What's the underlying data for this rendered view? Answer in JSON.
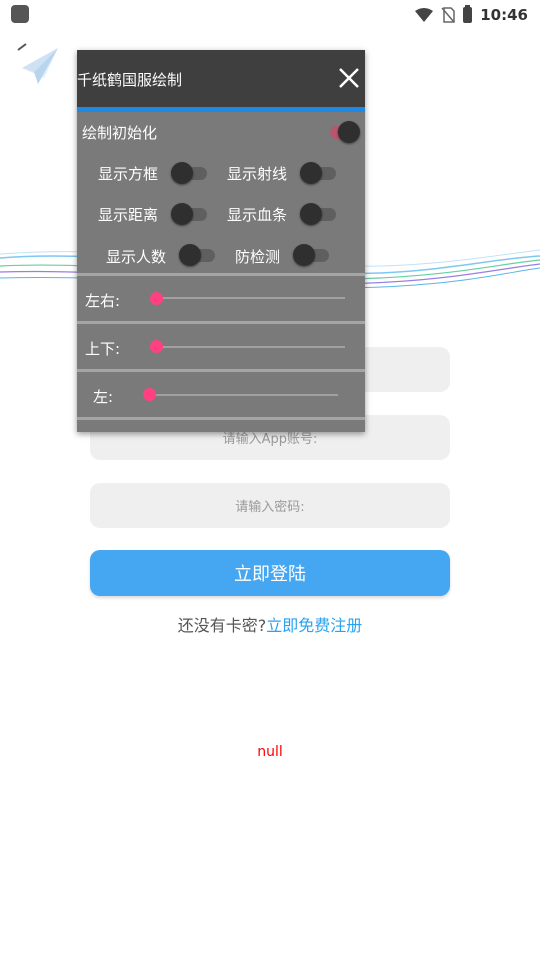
{
  "status_bar": {
    "time": "10:46"
  },
  "login": {
    "account_placeholder": "请输入App账号:",
    "password_placeholder": "请输入密码:",
    "login_button": "立即登陆",
    "no_card_text": "还没有卡密?",
    "register_link": "立即免费注册",
    "debug_text": "null"
  },
  "panel": {
    "title": "千纸鹤国服绘制",
    "init_label": "绘制初始化",
    "init_on": true,
    "toggles": [
      {
        "label": "显示方框",
        "on": false
      },
      {
        "label": "显示射线",
        "on": false
      },
      {
        "label": "显示距离",
        "on": false
      },
      {
        "label": "显示血条",
        "on": false
      },
      {
        "label": "显示人数",
        "on": false
      },
      {
        "label": "防检测",
        "on": false
      }
    ],
    "sliders": [
      {
        "label": "左右:",
        "value": 0
      },
      {
        "label": "上下:",
        "value": 0
      },
      {
        "label": "左:",
        "value": 0
      }
    ]
  },
  "colors": {
    "accent_blue": "#1e88e5",
    "login_button": "#45a6f1",
    "link": "#2aa2f0",
    "slider_thumb": "#ff4081",
    "debug_text": "#ff0000"
  }
}
